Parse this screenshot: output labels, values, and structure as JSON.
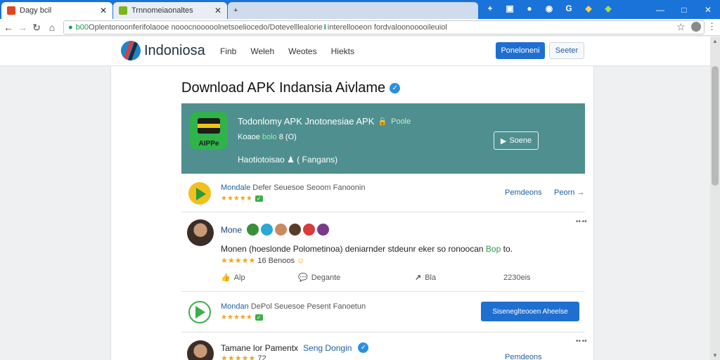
{
  "browser": {
    "tabs": [
      {
        "label": "Dagy bcil",
        "favicon_color": "#e0481f"
      },
      {
        "label": "Trnnomeiaonaltes",
        "favicon_color": "#7ab51d"
      },
      {
        "label": ""
      }
    ],
    "new_tab_label": "+",
    "toolbar_icons": [
      "puzzle-icon",
      "shield-icon",
      "account-icon",
      "google-icon",
      "bolt-icon",
      "flag-icon"
    ],
    "address": {
      "prefix": "b00 ",
      "url": "Oplentonoonferifolaooe nooocnooooolnetsoeliocedo/Dotevelllealorie",
      "secure_mark": "I",
      "suffix": " interellooeon fordvaloonooooileuiol"
    }
  },
  "site": {
    "brand": "Indoniosa",
    "nav": [
      "Finb",
      "Weleh",
      "Weotes",
      "Hiekts"
    ],
    "primary_button": "Poneloneni",
    "secondary_button": "Seeter"
  },
  "page": {
    "title": "Download APK Indansia Aivlame",
    "hero": {
      "title": "Todonlomy APK Jnotonesiae APK",
      "badge": "Poole",
      "meta_prefix": "Koaoe ",
      "meta_rating": "bolo",
      "meta_suffix": " 8 (O)",
      "subtitle": "Haotiotoisao",
      "subtitle_tail": "( Fangans)",
      "button": "Soene",
      "icon_tag": "AIPPe"
    },
    "items": [
      {
        "type": "app",
        "name": "Mondale",
        "desc": " Defer Seuesoe Seoom Fanoonin",
        "stars": "★★★★★",
        "action": "Pemdeons",
        "secondary": "Peorn →"
      },
      {
        "type": "post",
        "name": "Mone",
        "text": "Monen (hoeslonde Polometinoa) deniarnder stdeunr eker so ronoocan",
        "text_tag": "Bop",
        "text_tail": "to.",
        "stars": "★★★★★",
        "stars_suffix": " 16 Benoos",
        "actions": {
          "like": "Alp",
          "comment": "Degante",
          "share": "Bla",
          "count": "2230eis"
        }
      },
      {
        "type": "app",
        "name": "Mondan",
        "desc": " DePol Seuesoe Pesent Fanoetun",
        "stars": "★★★★★",
        "button": "Siseneglteooen Aheelse"
      },
      {
        "type": "post",
        "name": "Tamane lor Pamentx",
        "name_tail": "Seng Dongin",
        "stars": "★★★★★",
        "stars_suffix": " 72",
        "action": "Pemdeons"
      }
    ]
  }
}
